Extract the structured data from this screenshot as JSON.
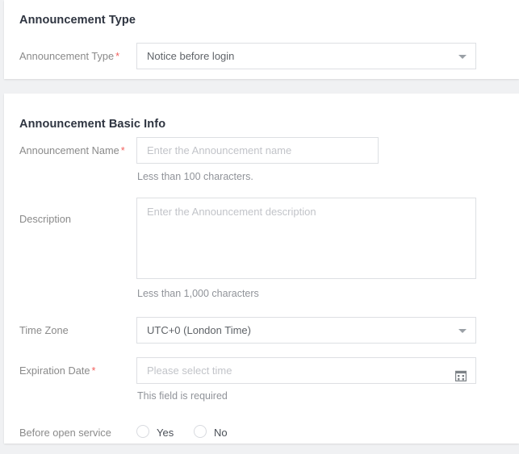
{
  "page": {
    "background_color": "#f0f1f3",
    "accent_required_color": "#f25f5c"
  },
  "announcement_type_section": {
    "title": "Announcement Type",
    "fields": {
      "announcement_type": {
        "label": "Announcement Type",
        "required_marker": "*",
        "control": "select",
        "value": "Notice before login",
        "caret_icon": "chevron-down-icon"
      }
    }
  },
  "announcement_basic_info_section": {
    "title": "Announcement Basic Info",
    "fields": {
      "announcement_name": {
        "label": "Announcement Name",
        "required_marker": "*",
        "control": "text-input",
        "value": "",
        "placeholder": "Enter the Announcement name",
        "helper_text": "Less than 100 characters."
      },
      "description": {
        "label": "Description",
        "required_marker": "",
        "control": "textarea",
        "value": "",
        "placeholder": "Enter the Announcement description",
        "helper_text": "Less than 1,000 characters"
      },
      "time_zone": {
        "label": "Time Zone",
        "required_marker": "",
        "control": "select",
        "value": "UTC+0 (London Time)",
        "caret_icon": "chevron-down-icon"
      },
      "expiration_date": {
        "label": "Expiration Date",
        "required_marker": "*",
        "control": "date-picker",
        "value": "",
        "placeholder": "Please select time",
        "helper_text": "This field is required",
        "trailing_icon": "calendar-icon"
      },
      "before_open_service": {
        "label": "Before open service",
        "required_marker": "",
        "control": "radio-group",
        "selected": "",
        "options": [
          {
            "label": "Yes",
            "value": "yes",
            "checked": false
          },
          {
            "label": "No",
            "value": "no",
            "checked": false
          }
        ]
      }
    }
  }
}
